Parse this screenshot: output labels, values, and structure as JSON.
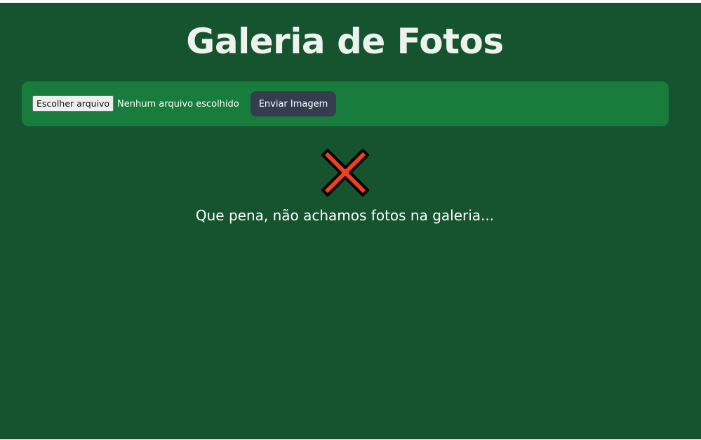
{
  "header": {
    "title": "Galeria de Fotos"
  },
  "upload": {
    "choose_file_label": "Escolher arquivo",
    "file_status": "Nenhum arquivo escolhido",
    "submit_label": "Enviar Imagem"
  },
  "empty_state": {
    "icon": "cross-mark-icon",
    "message": "Que pena, não achamos fotos na galeria..."
  },
  "colors": {
    "background": "#165430",
    "upload_bar": "#187c3c",
    "submit_button": "#343d4f",
    "cross_fill": "#f13f1f",
    "cross_outline": "#000000"
  }
}
